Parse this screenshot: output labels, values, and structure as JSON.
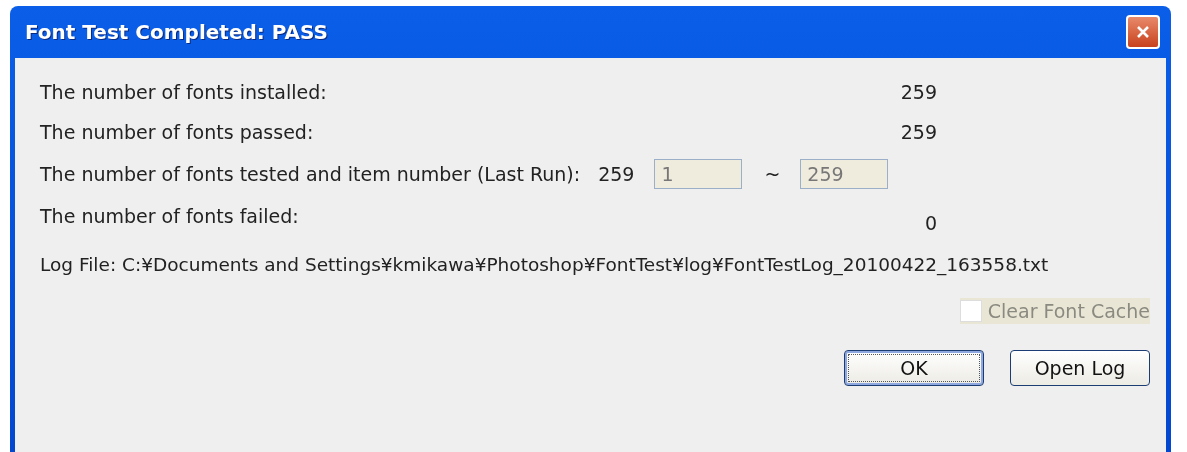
{
  "window": {
    "title": "Font Test Completed: PASS"
  },
  "stats": [
    {
      "label": "The number of fonts installed:",
      "value": "259"
    },
    {
      "label": "The number of fonts passed:",
      "value": "259"
    }
  ],
  "range_row": {
    "label": "The number of fonts tested and item number (Last Run):",
    "value": "259",
    "from": {
      "value": "1",
      "disabled": true
    },
    "separator": "~",
    "to": {
      "value": "259",
      "disabled": true
    }
  },
  "failed": {
    "label": "The number of fonts failed:",
    "value": "0"
  },
  "log_file": "Log File: C:¥Documents and Settings¥kmikawa¥Photoshop¥FontTest¥log¥FontTestLog_20100422_163558.txt",
  "clear_cache": {
    "label": "Clear Font Cache",
    "checked": false,
    "disabled": true
  },
  "buttons": [
    {
      "label": "OK",
      "default": true
    },
    {
      "label": "Open Log",
      "default": false
    }
  ]
}
